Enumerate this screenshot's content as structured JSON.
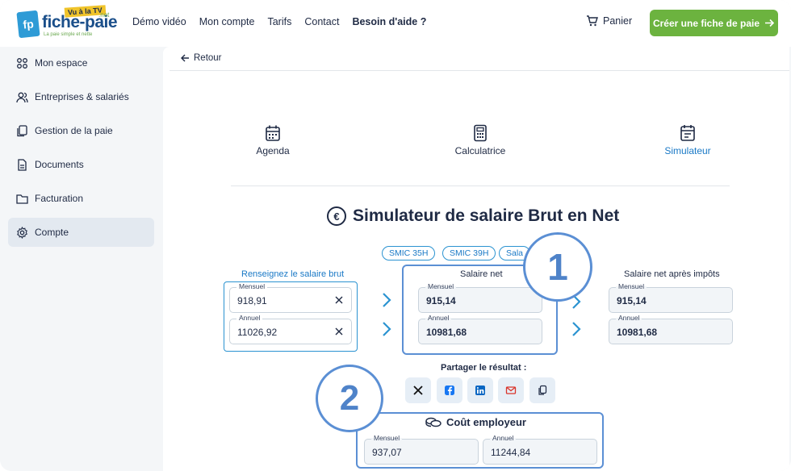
{
  "header": {
    "logo_word": "fiche-paie",
    "logo_tv": "Vu à la TV",
    "logo_net": ".net",
    "logo_tagline": "La paie simple et nette",
    "nav": [
      "Démo vidéo",
      "Mon compte",
      "Tarifs",
      "Contact",
      "Besoin d'aide ?"
    ],
    "cart_label": "Panier",
    "cta_label": "Créer une fiche de paie"
  },
  "sidebar": {
    "items": [
      {
        "label": "Mon espace",
        "icon": "grid-icon"
      },
      {
        "label": "Entreprises & salariés",
        "icon": "users-icon"
      },
      {
        "label": "Gestion de la paie",
        "icon": "file-copy-icon"
      },
      {
        "label": "Documents",
        "icon": "document-icon"
      },
      {
        "label": "Facturation",
        "icon": "folder-icon"
      },
      {
        "label": "Compte",
        "icon": "gear-icon",
        "active": true
      }
    ]
  },
  "content": {
    "back_label": "Retour",
    "tools": [
      {
        "label": "Agenda",
        "icon": "calendar-icon"
      },
      {
        "label": "Calculatrice",
        "icon": "calculator-icon"
      },
      {
        "label": "Simulateur",
        "icon": "simulator-icon",
        "active": true
      }
    ],
    "title": "Simulateur de salaire Brut en Net",
    "euro_symbol": "€",
    "chips": [
      "SMIC 35H",
      "SMIC 39H",
      "Sala"
    ],
    "brut": {
      "label": "Renseignez le salaire brut",
      "monthly_label": "Mensuel",
      "monthly_value": "918,91",
      "annual_label": "Annuel",
      "annual_value": "11026,92"
    },
    "net": {
      "label": "Salaire net",
      "monthly_label": "Mensuel",
      "monthly_value": "915,14",
      "annual_label": "Annuel",
      "annual_value": "10981,68"
    },
    "net_after_tax": {
      "label": "Salaire net après impôts",
      "monthly_label": "Mensuel",
      "monthly_value": "915,14",
      "annual_label": "Annuel",
      "annual_value": "10981,68"
    },
    "share_label": "Partager le résultat :",
    "share_buttons": [
      "x-icon",
      "facebook-icon",
      "linkedin-icon",
      "mail-icon",
      "copy-icon"
    ],
    "cost": {
      "title": "Coût employeur",
      "monthly_label": "Mensuel",
      "monthly_value": "937,07",
      "annual_label": "Annuel",
      "annual_value": "11244,84"
    },
    "callouts": [
      "1",
      "2"
    ]
  },
  "colors": {
    "accent_blue": "#1a79c6",
    "green_cta": "#6cb33f",
    "callout": "#5b8fd4",
    "navy_text": "#1f2a44"
  }
}
